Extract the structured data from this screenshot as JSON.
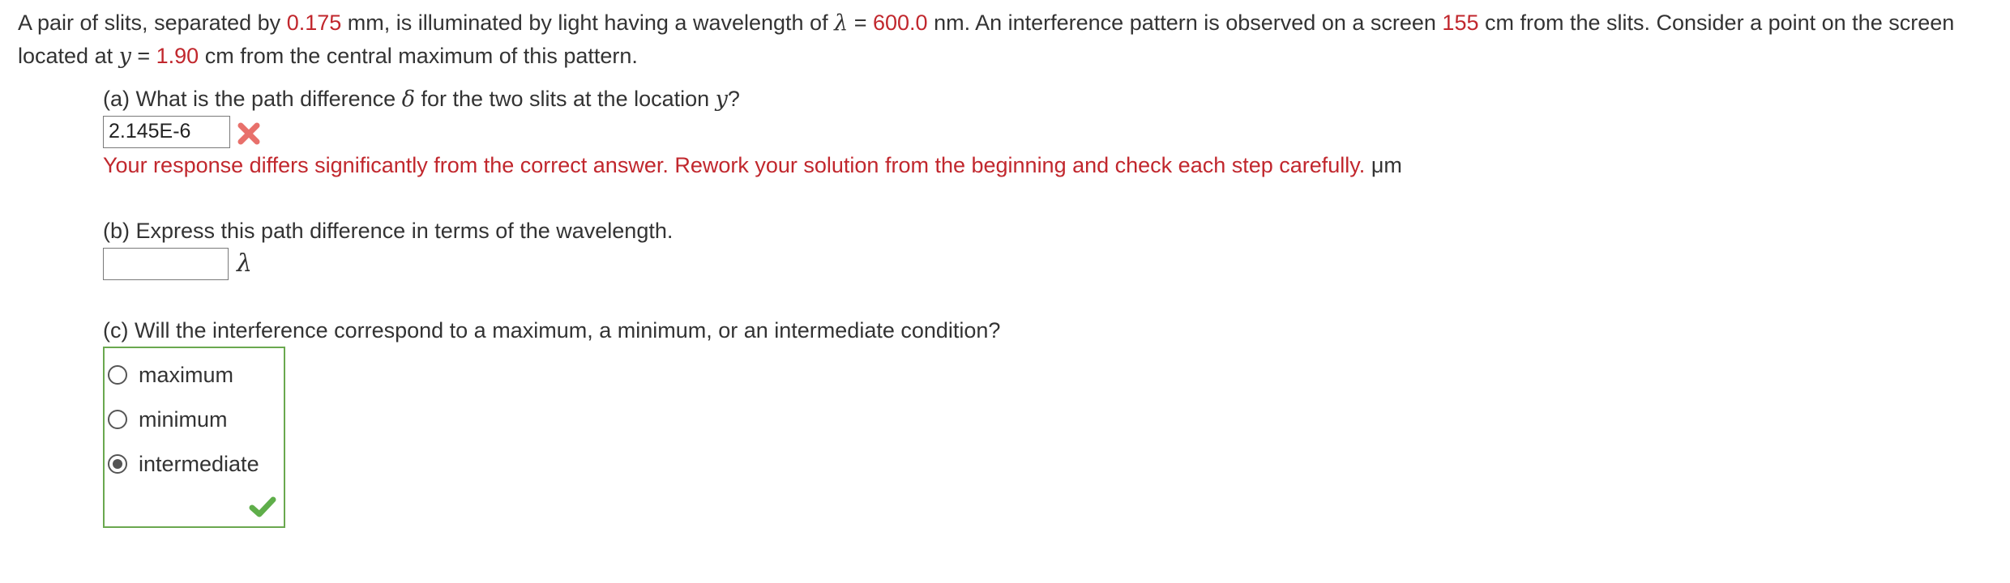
{
  "problem": {
    "seg1": "A pair of slits, separated by ",
    "slit_sep_value": "0.175",
    "seg2": " mm, is illuminated by light having a wavelength of ",
    "lambda_symbol": "λ",
    "seg3": " = ",
    "wavelength_value": "600.0",
    "seg4": " nm. An interference pattern is observed on a screen ",
    "screen_dist_value": "155",
    "seg5": " cm from the slits. Consider a point on the screen located at ",
    "y_symbol": "y",
    "seg6": " = ",
    "y_value": "1.90",
    "seg7": " cm from the central maximum of this pattern."
  },
  "part_a": {
    "question_prefix": "(a) What is the path difference ",
    "delta_symbol": "δ",
    "question_mid": " for the two slits at the location ",
    "y_symbol": "y",
    "question_suffix": "?",
    "answer_value": "2.145E-6",
    "status_icon": "x-mark-icon",
    "feedback_text": "Your response differs significantly from the correct answer. Rework your solution from the beginning and check each step carefully.",
    "unit": " μm"
  },
  "part_b": {
    "question": "(b) Express this path difference in terms of the wavelength.",
    "answer_value": "",
    "unit": "λ"
  },
  "part_c": {
    "question": "(c) Will the interference correspond to a maximum, a minimum, or an intermediate condition?",
    "options": [
      {
        "label": "maximum",
        "selected": false
      },
      {
        "label": "minimum",
        "selected": false
      },
      {
        "label": "intermediate",
        "selected": true
      }
    ],
    "status_icon": "check-mark-icon"
  },
  "colors": {
    "given_value": "#c1272d",
    "feedback_error": "#c1272d",
    "x_mark": "#e8706b",
    "correct_border": "#6aa84f",
    "check_mark": "#5fae4a"
  }
}
